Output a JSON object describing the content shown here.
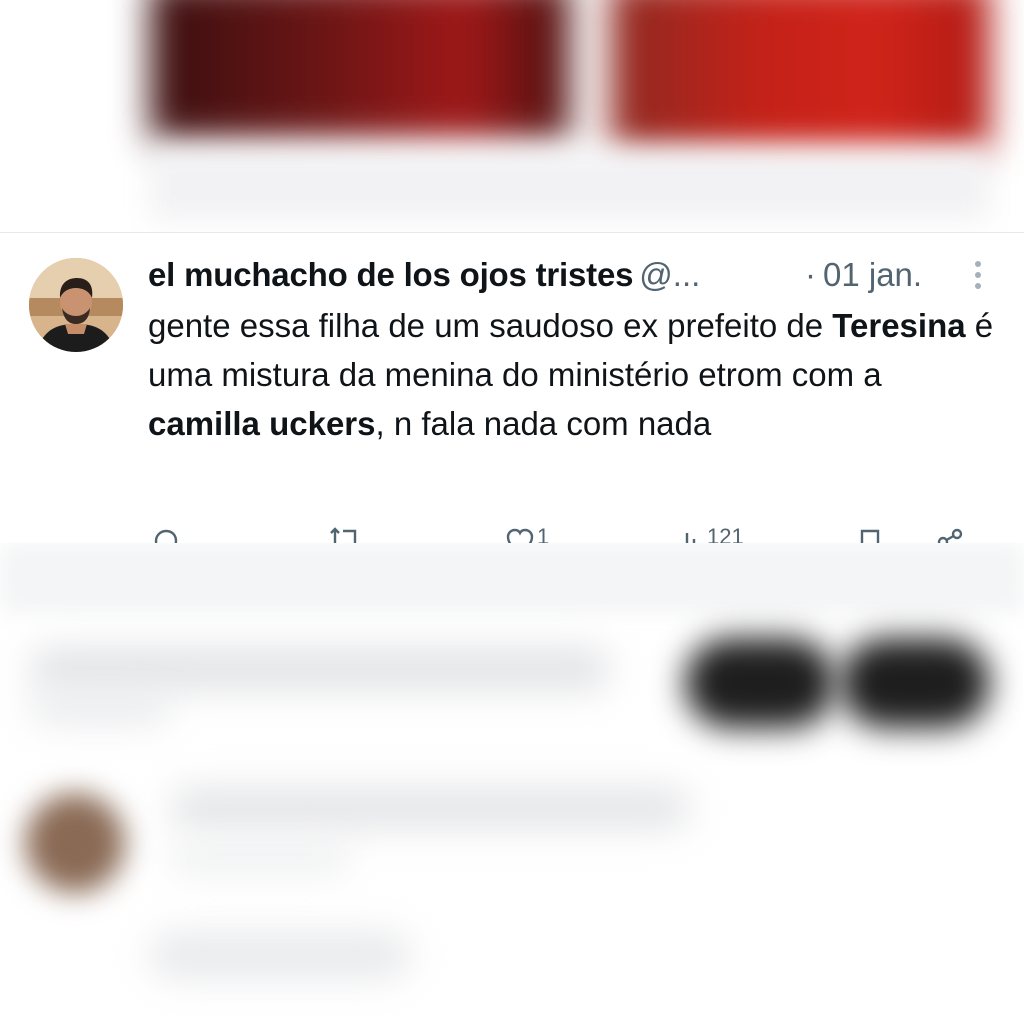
{
  "tweet": {
    "display_name": "el muchacho de los ojos tristes",
    "handle": "@...",
    "separator": "·",
    "time": "01 jan.",
    "text": {
      "part1": "gente essa filha de um saudoso ex prefeito de ",
      "bold1": "Teresina",
      "part2": " é uma mistura da menina do ministério etrom com a ",
      "bold2": "camilla uckers",
      "part3": ", n fala nada com nada"
    },
    "actions": {
      "reply_icon": "reply-icon",
      "retweet_icon": "retweet-icon",
      "like_icon": "heart-icon",
      "like_count": "1",
      "views_icon": "views-icon",
      "views_count": "121",
      "bookmark_icon": "bookmark-icon",
      "share_icon": "share-icon"
    }
  },
  "colors": {
    "text_primary": "#0f1419",
    "text_secondary": "#536471",
    "divider": "#e6e8ea",
    "top_media_red": "#c42118"
  }
}
